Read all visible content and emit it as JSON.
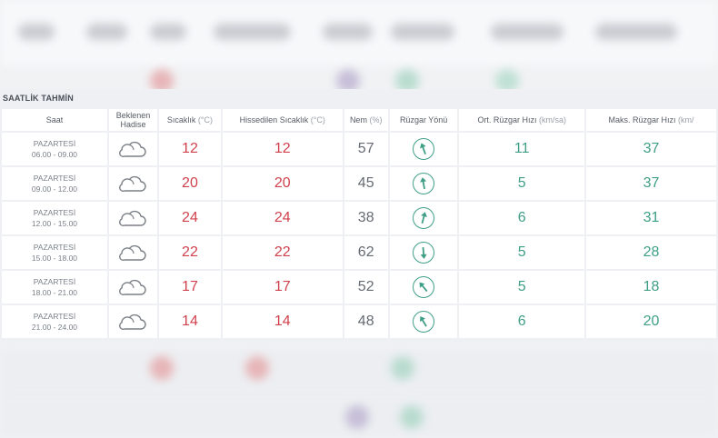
{
  "section_title": "SAATLİK TAHMİN",
  "headers": {
    "saat": "Saat",
    "hadise": [
      "Beklenen",
      "Hadise"
    ],
    "sicaklik": {
      "label": "Sıcaklık",
      "unit": "(°C)"
    },
    "hissedilen": {
      "label": "Hissedilen Sıcaklık",
      "unit": "(°C)"
    },
    "nem": {
      "label": "Nem",
      "unit": "(%)"
    },
    "ruzgar_yonu": "Rüzgar Yönü",
    "ort_ruzgar": {
      "label": "Ort. Rüzgar Hızı",
      "unit": "(km/sa)"
    },
    "maks_ruzgar": {
      "label": "Maks. Rüzgar Hızı",
      "unit": "(km/"
    }
  },
  "rows": [
    {
      "day": "PAZARTESİ",
      "time": "06.00 - 09.00",
      "icon": "cloud-icon",
      "temp": "12",
      "feels": "12",
      "humidity": "57",
      "wind_dir_deg": 340,
      "avg_wind": "11",
      "max_wind": "37"
    },
    {
      "day": "PAZARTESİ",
      "time": "09.00 - 12.00",
      "icon": "cloud-icon",
      "temp": "20",
      "feels": "20",
      "humidity": "45",
      "wind_dir_deg": 350,
      "avg_wind": "5",
      "max_wind": "37"
    },
    {
      "day": "PAZARTESİ",
      "time": "12.00 - 15.00",
      "icon": "cloud-icon",
      "temp": "24",
      "feels": "24",
      "humidity": "38",
      "wind_dir_deg": 15,
      "avg_wind": "6",
      "max_wind": "31"
    },
    {
      "day": "PAZARTESİ",
      "time": "15.00 - 18.00",
      "icon": "cloud-icon",
      "temp": "22",
      "feels": "22",
      "humidity": "62",
      "wind_dir_deg": 175,
      "avg_wind": "5",
      "max_wind": "28"
    },
    {
      "day": "PAZARTESİ",
      "time": "18.00 - 21.00",
      "icon": "cloud-icon",
      "temp": "17",
      "feels": "17",
      "humidity": "52",
      "wind_dir_deg": 320,
      "avg_wind": "5",
      "max_wind": "18"
    },
    {
      "day": "PAZARTESİ",
      "time": "21.00 - 24.00",
      "icon": "cloud-icon",
      "temp": "14",
      "feels": "14",
      "humidity": "48",
      "wind_dir_deg": 330,
      "avg_wind": "6",
      "max_wind": "20"
    }
  ],
  "colors": {
    "temperature": "#d0414d",
    "wind": "#3e9e86",
    "humidity": "#666b73"
  }
}
